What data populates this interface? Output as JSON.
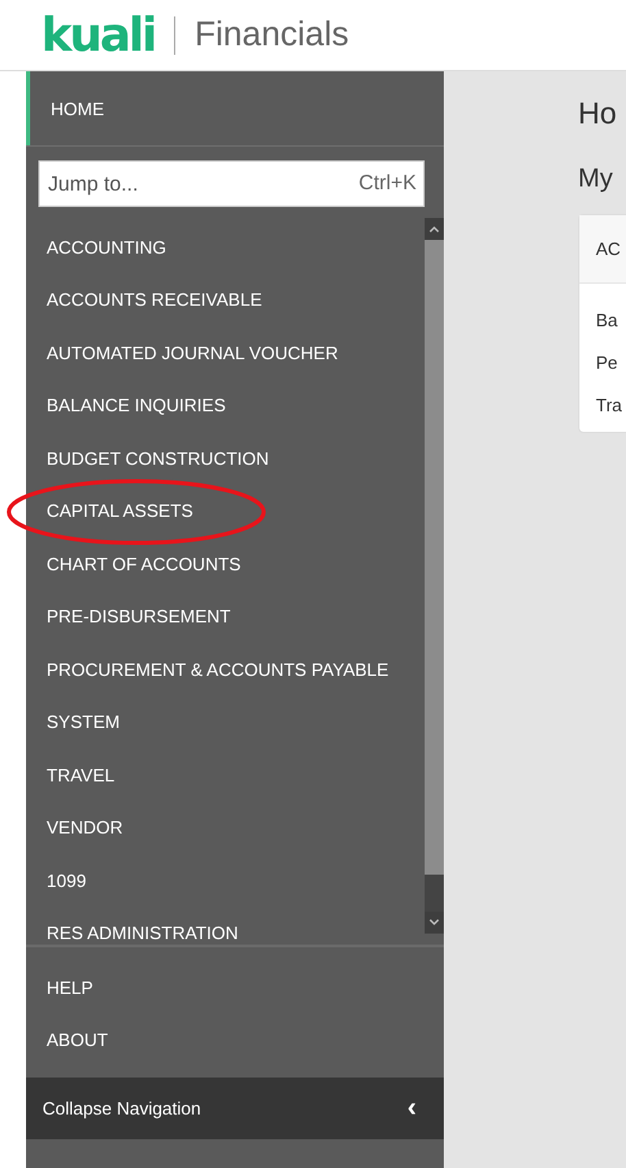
{
  "header": {
    "logo": "kuali",
    "product": "Financials"
  },
  "sidebar": {
    "home": {
      "label": "HOME",
      "selected": true
    },
    "jump": {
      "placeholder": "Jump to...",
      "shortcut": "Ctrl+K"
    },
    "items": [
      {
        "label": "ACCOUNTING",
        "circled": false
      },
      {
        "label": "ACCOUNTS RECEIVABLE",
        "circled": false
      },
      {
        "label": "AUTOMATED JOURNAL VOUCHER",
        "circled": false
      },
      {
        "label": "BALANCE INQUIRIES",
        "circled": false
      },
      {
        "label": "BUDGET CONSTRUCTION",
        "circled": false
      },
      {
        "label": "CAPITAL ASSETS",
        "circled": true
      },
      {
        "label": "CHART OF ACCOUNTS",
        "circled": false
      },
      {
        "label": "PRE-DISBURSEMENT",
        "circled": false
      },
      {
        "label": "PROCUREMENT & ACCOUNTS PAYABLE",
        "circled": false
      },
      {
        "label": "SYSTEM",
        "circled": false
      },
      {
        "label": "TRAVEL",
        "circled": false
      },
      {
        "label": "VENDOR",
        "circled": false
      },
      {
        "label": "1099",
        "circled": false
      },
      {
        "label": "RES ADMINISTRATION",
        "circled": false
      }
    ],
    "footer_items": [
      "HELP",
      "ABOUT"
    ],
    "collapse": {
      "label": "Collapse Navigation",
      "icon": "‹"
    }
  },
  "main": {
    "title": "Ho",
    "section": "My",
    "card": {
      "title": "AC",
      "rows": [
        "Ba",
        "Pe",
        "Tra"
      ]
    }
  }
}
